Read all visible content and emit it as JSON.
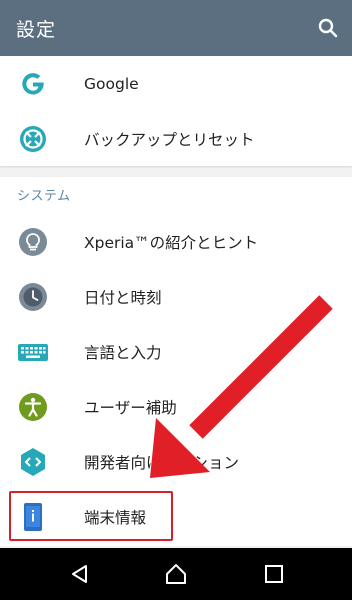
{
  "appbar": {
    "title": "設定",
    "search_icon": "search-icon"
  },
  "top_items": [
    {
      "label": "Google",
      "icon": "google-icon"
    },
    {
      "label": "バックアップとリセット",
      "icon": "backup-reset-icon"
    }
  ],
  "system_section": {
    "header": "システム",
    "items": [
      {
        "label": "Xperia™の紹介とヒント",
        "icon": "lightbulb-icon"
      },
      {
        "label": "日付と時刻",
        "icon": "clock-icon"
      },
      {
        "label": "言語と入力",
        "icon": "keyboard-icon"
      },
      {
        "label": "ユーザー補助",
        "icon": "accessibility-icon"
      },
      {
        "label": "開発者向けオプション",
        "icon": "developer-icon"
      },
      {
        "label": "端末情報",
        "icon": "device-info-icon"
      }
    ]
  },
  "navbar": {
    "back": "back-icon",
    "home": "home-icon",
    "recents": "recents-icon"
  },
  "colors": {
    "appbar": "#5b6f80",
    "accent": "#26a8b8",
    "highlight": "#d9202a",
    "section": "#5a87aa"
  }
}
